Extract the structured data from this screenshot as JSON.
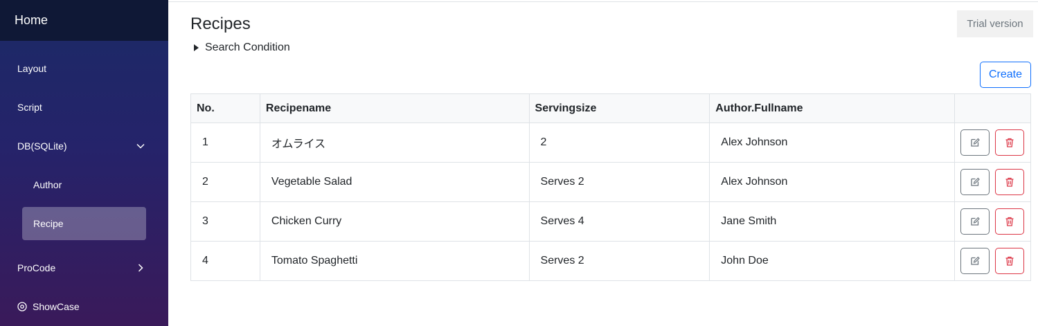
{
  "sidebar": {
    "home_label": "Home",
    "items": [
      {
        "label": "Layout"
      },
      {
        "label": "Script"
      },
      {
        "label": "DB(SQLite)"
      },
      {
        "label": "Author"
      },
      {
        "label": "Recipe"
      },
      {
        "label": "ProCode"
      },
      {
        "label": "ShowCase"
      }
    ]
  },
  "header": {
    "title": "Recipes",
    "trial_label": "Trial version",
    "search_condition_label": "Search Condition",
    "create_label": "Create"
  },
  "table": {
    "columns": [
      "No.",
      "Recipename",
      "Servingsize",
      "Author.Fullname",
      ""
    ],
    "rows": [
      {
        "no": "1",
        "recipename": "オムライス",
        "servingsize": "2",
        "author": "Alex Johnson"
      },
      {
        "no": "2",
        "recipename": "Vegetable Salad",
        "servingsize": "Serves 2",
        "author": "Alex Johnson"
      },
      {
        "no": "3",
        "recipename": "Chicken Curry",
        "servingsize": "Serves 4",
        "author": "Jane Smith"
      },
      {
        "no": "4",
        "recipename": "Tomato Spaghetti",
        "servingsize": "Serves 2",
        "author": "John Doe"
      }
    ]
  },
  "colors": {
    "primary": "#0d6efd",
    "danger": "#dc3545",
    "secondary": "#6c757d"
  },
  "icons": {
    "edit": "edit-icon",
    "delete": "trash-icon",
    "expand": "chevron-down-icon",
    "collapsed": "chevron-right-icon",
    "showcase": "circle-icon"
  }
}
